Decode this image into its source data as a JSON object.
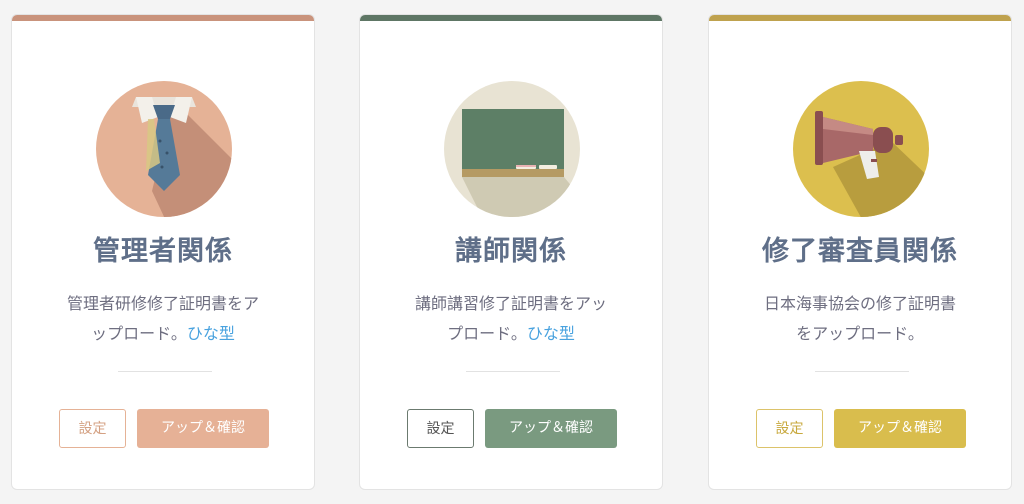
{
  "cards": [
    {
      "title": "管理者関係",
      "desc_line1": "管理者研修修了証明書をア",
      "desc_line2": "ップロード。",
      "link": "ひな型",
      "settings_label": "設定",
      "upload_label": "アップ＆確認",
      "accent": "#c9937c",
      "button_color": "#e6b196",
      "icon": "necktie-icon"
    },
    {
      "title": "講師関係",
      "desc_line1": "講師講習修了証明書をアッ",
      "desc_line2": "プロード。",
      "link": "ひな型",
      "settings_label": "設定",
      "upload_label": "アップ＆確認",
      "accent": "#5e7665",
      "button_color": "#7a9a80",
      "icon": "blackboard-icon"
    },
    {
      "title": "修了審査員関係",
      "desc_line1": "日本海事協会の修了証明書",
      "desc_line2": "をアップロード。",
      "link": "",
      "settings_label": "設定",
      "upload_label": "アップ＆確認",
      "accent": "#bfa24e",
      "button_color": "#d9bd4d",
      "icon": "megaphone-icon"
    }
  ]
}
